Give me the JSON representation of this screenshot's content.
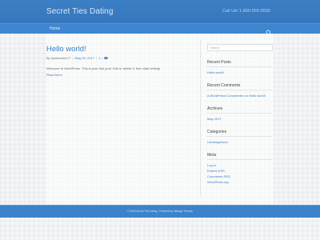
{
  "header": {
    "site_title": "Secret Ties Dating",
    "contact": "Call Us! 1-800-555-5555"
  },
  "nav": {
    "home": "Home"
  },
  "post": {
    "title": "Hello world!",
    "author": "By tyadsadmin77",
    "date": "May 20, 2017",
    "comments_count": "1",
    "excerpt": "Welcome to WordPress. This is your first post. Edit or delete it, then start writing!",
    "read_more": "Read More"
  },
  "sidebar": {
    "search_placeholder": "Search",
    "recent_posts": {
      "title": "Recent Posts",
      "items": [
        "Hello world!"
      ]
    },
    "recent_comments": {
      "title": "Recent Comments",
      "items": [
        "A WordPress Commenter on Hello world!"
      ]
    },
    "archives": {
      "title": "Archives",
      "items": [
        "May 2017"
      ]
    },
    "categories": {
      "title": "Categories",
      "items": [
        "Uncategorized"
      ]
    },
    "meta": {
      "title": "Meta",
      "items": [
        "Log in",
        "Entries RSS",
        "Comments RSS",
        "WordPress.org"
      ]
    }
  },
  "footer": {
    "text": "© 2018 Secret Ties Dating - Powered by Vantage Themes"
  },
  "colors": {
    "accent": "#3a80c5",
    "header": "#3576bd",
    "footer": "#3c83cc"
  }
}
